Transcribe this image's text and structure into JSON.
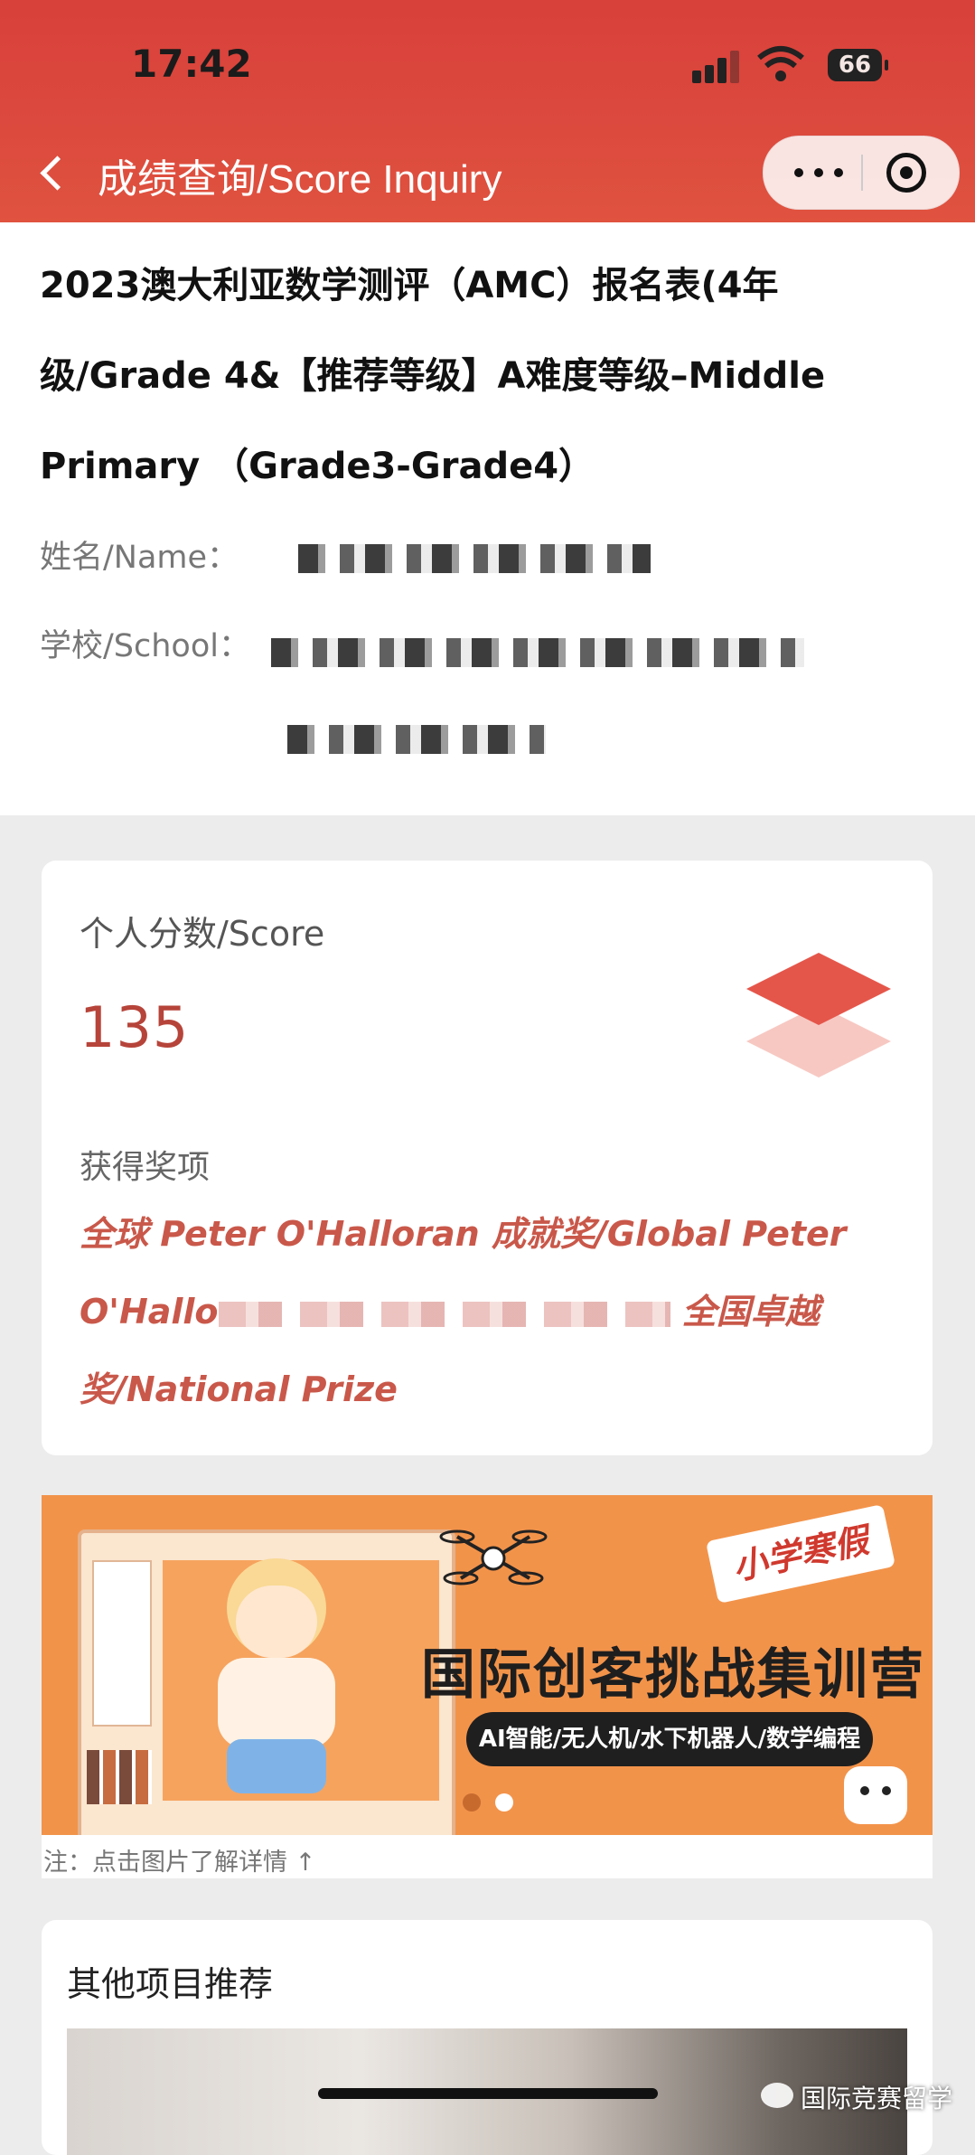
{
  "status_bar": {
    "time": "17:42",
    "battery": "66"
  },
  "nav": {
    "title": "成绩查询/Score Inquiry"
  },
  "info": {
    "exam_title": "2023澳大利亚数学测评（AMC）报名表(4年级/Grade 4&【推荐等级】A难度等级–Middle Primary （Grade3-Grade4）",
    "name_label": "姓名/Name：",
    "school_label": "学校/School："
  },
  "score": {
    "label": "个人分数/Score",
    "value": "135",
    "award_label": "获得奖项",
    "award_part1": "全球 Peter O'Halloran 成就奖/Global Peter O'Hallo",
    "award_part2": "全国卓越奖/National Prize",
    "accent_color": "#c9584a"
  },
  "banner": {
    "tag": "小学寒假",
    "headline": "国际创客挑战集训营",
    "subline": "AI智能/无人机/水下机器人/数学编程",
    "note": "注：点击图片了解详情 ↑"
  },
  "other": {
    "title": "其他项目推荐"
  },
  "watermark": "国际竞赛留学",
  "icons": [
    "back-chevron-icon",
    "more-icon",
    "target-icon",
    "layers-icon",
    "drone-icon",
    "robot-icon",
    "wechat-icon"
  ]
}
